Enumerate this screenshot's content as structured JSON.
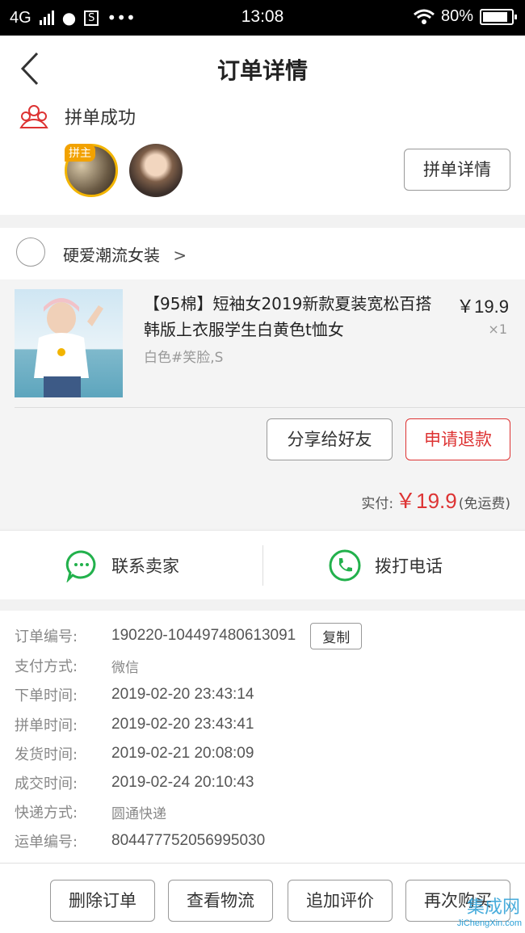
{
  "status_bar": {
    "network": "4G",
    "time": "13:08",
    "battery": "80%"
  },
  "nav": {
    "title": "订单详情"
  },
  "group": {
    "status": "拼单成功",
    "host_badge": "拼主",
    "detail_button": "拼单详情"
  },
  "shop": {
    "name": "硬爱潮流女装"
  },
  "product": {
    "title": "【95棉】短袖女2019新款夏装宽松百搭韩版上衣服学生白黄色t恤女",
    "price": "￥19.9",
    "qty": "×1",
    "spec": "白色#笑脸,S"
  },
  "actions": {
    "share": "分享给好友",
    "refund": "申请退款"
  },
  "payment": {
    "label": "实付:",
    "amount": "￥19.9",
    "note": "(免运费)"
  },
  "contact": {
    "seller": "联系卖家",
    "call": "拨打电话"
  },
  "info": {
    "rows": [
      {
        "label": "订单编号:",
        "value": "190220-104497480613091"
      },
      {
        "label": "支付方式:",
        "value": "微信"
      },
      {
        "label": "下单时间:",
        "value": "2019-02-20 23:43:14"
      },
      {
        "label": "拼单时间:",
        "value": "2019-02-20 23:43:41"
      },
      {
        "label": "发货时间:",
        "value": "2019-02-21 20:08:09"
      },
      {
        "label": "成交时间:",
        "value": "2019-02-24 20:10:43"
      },
      {
        "label": "快递方式:",
        "value": "圆通快递"
      },
      {
        "label": "运单编号:",
        "value": "804477752056995030"
      }
    ],
    "copy_button": "复制"
  },
  "bottom": {
    "delete": "删除订单",
    "logistics": "查看物流",
    "review": "追加评价",
    "rebuy": "再次购买"
  },
  "watermark": {
    "logo": "集成网",
    "text": "JiChengXin.com"
  },
  "icons": [
    "signal-icon",
    "qq-icon",
    "s-icon",
    "more-icon",
    "wifi-icon",
    "battery-icon",
    "back-icon",
    "group-icon",
    "chevron-right-icon",
    "chat-icon",
    "phone-icon"
  ],
  "colors": {
    "accent_red": "#d33333",
    "green": "#22b14c",
    "badge_orange": "#f2a200"
  }
}
